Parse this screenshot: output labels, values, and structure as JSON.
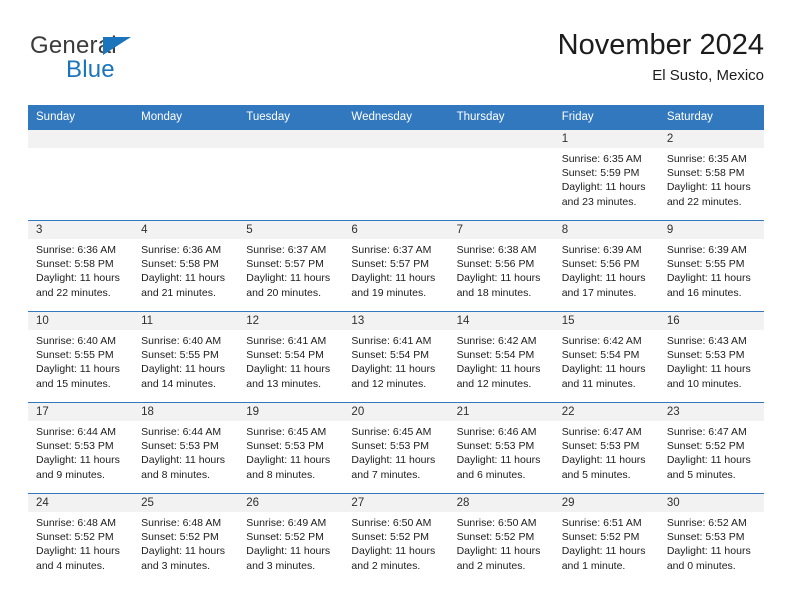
{
  "logo": {
    "word_one": "General",
    "word_two": "Blue",
    "triangle": "blue-triangle-icon",
    "accent_color": "#1b75bc"
  },
  "header": {
    "title": "November 2024",
    "subtitle": "El Susto, Mexico"
  },
  "theme": {
    "header_blue": "#3278be",
    "daynum_band": "#f2f2f2",
    "text": "#1c1c1c"
  },
  "calendar": {
    "weekday_headers": [
      "Sunday",
      "Monday",
      "Tuesday",
      "Wednesday",
      "Thursday",
      "Friday",
      "Saturday"
    ],
    "weeks": [
      [
        {
          "day": "",
          "sunrise": "",
          "sunset": "",
          "daylight": ""
        },
        {
          "day": "",
          "sunrise": "",
          "sunset": "",
          "daylight": ""
        },
        {
          "day": "",
          "sunrise": "",
          "sunset": "",
          "daylight": ""
        },
        {
          "day": "",
          "sunrise": "",
          "sunset": "",
          "daylight": ""
        },
        {
          "day": "",
          "sunrise": "",
          "sunset": "",
          "daylight": ""
        },
        {
          "day": "1",
          "sunrise": "Sunrise: 6:35 AM",
          "sunset": "Sunset: 5:59 PM",
          "daylight": "Daylight: 11 hours and 23 minutes."
        },
        {
          "day": "2",
          "sunrise": "Sunrise: 6:35 AM",
          "sunset": "Sunset: 5:58 PM",
          "daylight": "Daylight: 11 hours and 22 minutes."
        }
      ],
      [
        {
          "day": "3",
          "sunrise": "Sunrise: 6:36 AM",
          "sunset": "Sunset: 5:58 PM",
          "daylight": "Daylight: 11 hours and 22 minutes."
        },
        {
          "day": "4",
          "sunrise": "Sunrise: 6:36 AM",
          "sunset": "Sunset: 5:58 PM",
          "daylight": "Daylight: 11 hours and 21 minutes."
        },
        {
          "day": "5",
          "sunrise": "Sunrise: 6:37 AM",
          "sunset": "Sunset: 5:57 PM",
          "daylight": "Daylight: 11 hours and 20 minutes."
        },
        {
          "day": "6",
          "sunrise": "Sunrise: 6:37 AM",
          "sunset": "Sunset: 5:57 PM",
          "daylight": "Daylight: 11 hours and 19 minutes."
        },
        {
          "day": "7",
          "sunrise": "Sunrise: 6:38 AM",
          "sunset": "Sunset: 5:56 PM",
          "daylight": "Daylight: 11 hours and 18 minutes."
        },
        {
          "day": "8",
          "sunrise": "Sunrise: 6:39 AM",
          "sunset": "Sunset: 5:56 PM",
          "daylight": "Daylight: 11 hours and 17 minutes."
        },
        {
          "day": "9",
          "sunrise": "Sunrise: 6:39 AM",
          "sunset": "Sunset: 5:55 PM",
          "daylight": "Daylight: 11 hours and 16 minutes."
        }
      ],
      [
        {
          "day": "10",
          "sunrise": "Sunrise: 6:40 AM",
          "sunset": "Sunset: 5:55 PM",
          "daylight": "Daylight: 11 hours and 15 minutes."
        },
        {
          "day": "11",
          "sunrise": "Sunrise: 6:40 AM",
          "sunset": "Sunset: 5:55 PM",
          "daylight": "Daylight: 11 hours and 14 minutes."
        },
        {
          "day": "12",
          "sunrise": "Sunrise: 6:41 AM",
          "sunset": "Sunset: 5:54 PM",
          "daylight": "Daylight: 11 hours and 13 minutes."
        },
        {
          "day": "13",
          "sunrise": "Sunrise: 6:41 AM",
          "sunset": "Sunset: 5:54 PM",
          "daylight": "Daylight: 11 hours and 12 minutes."
        },
        {
          "day": "14",
          "sunrise": "Sunrise: 6:42 AM",
          "sunset": "Sunset: 5:54 PM",
          "daylight": "Daylight: 11 hours and 12 minutes."
        },
        {
          "day": "15",
          "sunrise": "Sunrise: 6:42 AM",
          "sunset": "Sunset: 5:54 PM",
          "daylight": "Daylight: 11 hours and 11 minutes."
        },
        {
          "day": "16",
          "sunrise": "Sunrise: 6:43 AM",
          "sunset": "Sunset: 5:53 PM",
          "daylight": "Daylight: 11 hours and 10 minutes."
        }
      ],
      [
        {
          "day": "17",
          "sunrise": "Sunrise: 6:44 AM",
          "sunset": "Sunset: 5:53 PM",
          "daylight": "Daylight: 11 hours and 9 minutes."
        },
        {
          "day": "18",
          "sunrise": "Sunrise: 6:44 AM",
          "sunset": "Sunset: 5:53 PM",
          "daylight": "Daylight: 11 hours and 8 minutes."
        },
        {
          "day": "19",
          "sunrise": "Sunrise: 6:45 AM",
          "sunset": "Sunset: 5:53 PM",
          "daylight": "Daylight: 11 hours and 8 minutes."
        },
        {
          "day": "20",
          "sunrise": "Sunrise: 6:45 AM",
          "sunset": "Sunset: 5:53 PM",
          "daylight": "Daylight: 11 hours and 7 minutes."
        },
        {
          "day": "21",
          "sunrise": "Sunrise: 6:46 AM",
          "sunset": "Sunset: 5:53 PM",
          "daylight": "Daylight: 11 hours and 6 minutes."
        },
        {
          "day": "22",
          "sunrise": "Sunrise: 6:47 AM",
          "sunset": "Sunset: 5:53 PM",
          "daylight": "Daylight: 11 hours and 5 minutes."
        },
        {
          "day": "23",
          "sunrise": "Sunrise: 6:47 AM",
          "sunset": "Sunset: 5:52 PM",
          "daylight": "Daylight: 11 hours and 5 minutes."
        }
      ],
      [
        {
          "day": "24",
          "sunrise": "Sunrise: 6:48 AM",
          "sunset": "Sunset: 5:52 PM",
          "daylight": "Daylight: 11 hours and 4 minutes."
        },
        {
          "day": "25",
          "sunrise": "Sunrise: 6:48 AM",
          "sunset": "Sunset: 5:52 PM",
          "daylight": "Daylight: 11 hours and 3 minutes."
        },
        {
          "day": "26",
          "sunrise": "Sunrise: 6:49 AM",
          "sunset": "Sunset: 5:52 PM",
          "daylight": "Daylight: 11 hours and 3 minutes."
        },
        {
          "day": "27",
          "sunrise": "Sunrise: 6:50 AM",
          "sunset": "Sunset: 5:52 PM",
          "daylight": "Daylight: 11 hours and 2 minutes."
        },
        {
          "day": "28",
          "sunrise": "Sunrise: 6:50 AM",
          "sunset": "Sunset: 5:52 PM",
          "daylight": "Daylight: 11 hours and 2 minutes."
        },
        {
          "day": "29",
          "sunrise": "Sunrise: 6:51 AM",
          "sunset": "Sunset: 5:52 PM",
          "daylight": "Daylight: 11 hours and 1 minute."
        },
        {
          "day": "30",
          "sunrise": "Sunrise: 6:52 AM",
          "sunset": "Sunset: 5:53 PM",
          "daylight": "Daylight: 11 hours and 0 minutes."
        }
      ]
    ]
  }
}
